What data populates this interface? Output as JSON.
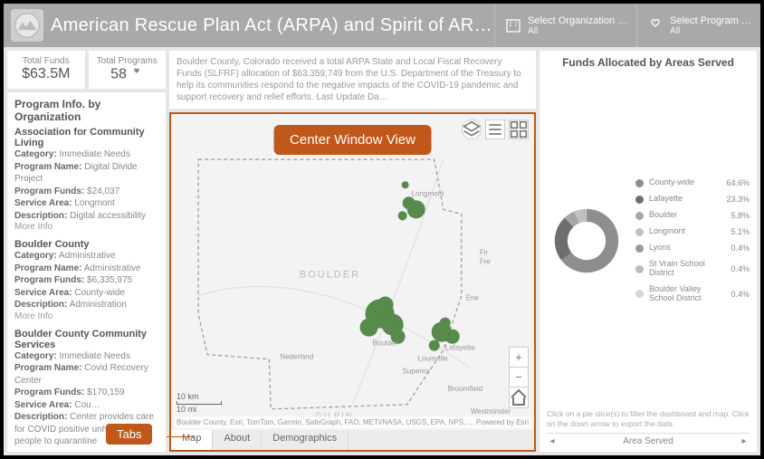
{
  "header": {
    "title": "American Rescue Plan Act (ARPA) and Spirit of ARPA Das…",
    "filters": [
      {
        "label": "Select Organization …",
        "value": "All"
      },
      {
        "label": "Select Program …",
        "value": "All"
      }
    ]
  },
  "kpis": {
    "funds_label": "Total Funds",
    "funds_value": "$63.5M",
    "programs_label": "Total Programs",
    "programs_value": "58"
  },
  "intro": "Boulder County, Colorado received a total ARPA State and Local Fiscal Recovery Funds (SLFRF) allocation of $63,359,749 from the U.S. Department of the Treasury to help its communities respond to the negative impacts of the COVID-19 pandemic and support recovery and relief efforts. Last Update Da…",
  "org_panel": {
    "title": "Program Info. by Organization",
    "orgs": [
      {
        "name": "Association for Community Living",
        "category": "Immediate Needs",
        "program": "Digital Divide Project",
        "funds": "$24,037",
        "area": "Longmont",
        "desc": "Digital accessibility",
        "more": "More Info"
      },
      {
        "name": "Boulder County",
        "category": "Administrative",
        "program": "Administrative",
        "funds": "$6,335,975",
        "area": "County-wide",
        "desc": "Administration",
        "more": "More Info"
      },
      {
        "name": "Boulder County Community Services",
        "category": "Immediate Needs",
        "program": "Covid Recovery Center",
        "funds": "$170,159",
        "area": "Cou…",
        "desc": "Center provides care for COVID positive unhoused people to quarantine",
        "more": ""
      }
    ]
  },
  "map": {
    "scale_km": "10 km",
    "scale_mi": "10 mi",
    "region_label": "BOULDER",
    "gilpin_label": "GILPIN",
    "cities": [
      "Nederland",
      "Longmont",
      "Boulder",
      "Lafayette",
      "Louisville",
      "Superior",
      "Broomfield",
      "Erie",
      "Westminster",
      "Firestone",
      "Frederick"
    ],
    "attrib_left": "Boulder County, Esri, TomTom, Garmin, SafeGraph, FAO, METI/NASA, USGS, EPA, NPS,…",
    "attrib_right": "Powered by Esri",
    "tabs": [
      "Map",
      "About",
      "Demographics"
    ]
  },
  "annotations": {
    "center": "Center Window View",
    "tabs": "Tabs"
  },
  "right": {
    "title": "Funds Allocated by Areas Served",
    "hint": "Click on a pie slice(s) to filter the dashboard and map. Click on the down arrow to export the data.",
    "pager_label": "Area Served"
  },
  "chart_data": {
    "type": "pie",
    "title": "Funds Allocated by Areas Served",
    "series": [
      {
        "name": "County-wide",
        "value": 64.6,
        "color": "#8e8e8e"
      },
      {
        "name": "Lafayette",
        "value": 23.3,
        "color": "#6e6e6e"
      },
      {
        "name": "Boulder",
        "value": 5.8,
        "color": "#a6a6a6"
      },
      {
        "name": "Longmont",
        "value": 5.1,
        "color": "#c1c1c1"
      },
      {
        "name": "Lyons",
        "value": 0.4,
        "color": "#9a9a9a"
      },
      {
        "name": "St Vrain School District",
        "value": 0.4,
        "color": "#bdbdbd"
      },
      {
        "name": "Boulder Valley School District",
        "value": 0.4,
        "color": "#d6d6d6"
      }
    ]
  }
}
